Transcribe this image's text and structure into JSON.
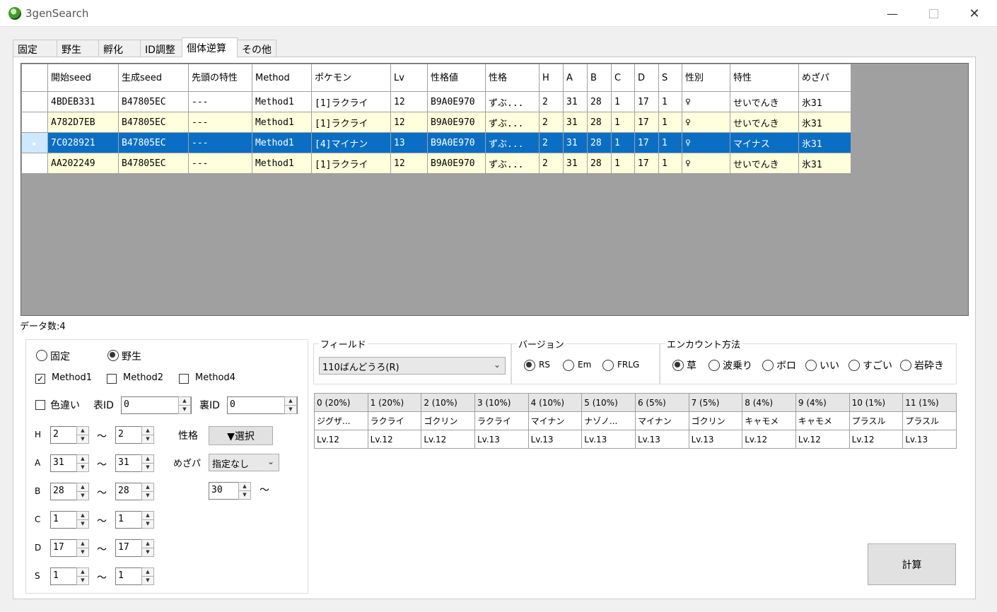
{
  "window": {
    "title": "3genSearch"
  },
  "tabs": [
    "固定",
    "野生",
    "孵化",
    "ID調整",
    "個体逆算",
    "その他"
  ],
  "results": {
    "columns": [
      "開始seed",
      "生成seed",
      "先頭の特性",
      "Method",
      "ポケモン",
      "Lv",
      "性格値",
      "性格",
      "H",
      "A",
      "B",
      "C",
      "D",
      "S",
      "性別",
      "特性",
      "めざパ"
    ],
    "rows": [
      [
        "4BDEB331",
        "B47805EC",
        "---",
        "Method1",
        "[1]ラクライ",
        "12",
        "B9A0E970",
        "ずぶ...",
        "2",
        "31",
        "28",
        "1",
        "17",
        "1",
        "♀",
        "せいでんき",
        "氷31"
      ],
      [
        "A782D7EB",
        "B47805EC",
        "---",
        "Method1",
        "[1]ラクライ",
        "12",
        "B9A0E970",
        "ずぶ...",
        "2",
        "31",
        "28",
        "1",
        "17",
        "1",
        "♀",
        "せいでんき",
        "氷31"
      ],
      [
        "7C028921",
        "B47805EC",
        "---",
        "Method1",
        "[4]マイナン",
        "13",
        "B9A0E970",
        "ずぶ...",
        "2",
        "31",
        "28",
        "1",
        "17",
        "1",
        "♀",
        "マイナス",
        "氷31"
      ],
      [
        "AA202249",
        "B47805EC",
        "---",
        "Method1",
        "[1]ラクライ",
        "12",
        "B9A0E970",
        "ずぶ...",
        "2",
        "31",
        "28",
        "1",
        "17",
        "1",
        "♀",
        "せいでんき",
        "氷31"
      ]
    ],
    "selected_row": 2
  },
  "count_label": "データ数:4",
  "mode": {
    "fixed": "固定",
    "wild": "野生",
    "selected": "野生"
  },
  "methods": [
    {
      "label": "Method1",
      "checked": true
    },
    {
      "label": "Method2",
      "checked": false
    },
    {
      "label": "Method4",
      "checked": false
    }
  ],
  "shiny": {
    "label": "色違い",
    "checked": false
  },
  "omote_id": {
    "label": "表ID",
    "value": "0"
  },
  "ura_id": {
    "label": "裏ID",
    "value": "0"
  },
  "stats": [
    {
      "label": "H",
      "min": "2",
      "max": "2"
    },
    {
      "label": "A",
      "min": "31",
      "max": "31"
    },
    {
      "label": "B",
      "min": "28",
      "max": "28"
    },
    {
      "label": "C",
      "min": "1",
      "max": "1"
    },
    {
      "label": "D",
      "min": "17",
      "max": "17"
    },
    {
      "label": "S",
      "min": "1",
      "max": "1"
    }
  ],
  "range_sep": "～",
  "nature": {
    "label": "性格",
    "button": "▼選択"
  },
  "hidden_power": {
    "label": "めざパ",
    "type": "指定なし",
    "power": "30",
    "sep": "～"
  },
  "field": {
    "legend": "フィールド",
    "value": "110ばんどうろ(R)"
  },
  "version": {
    "legend": "バージョン",
    "options": [
      "RS",
      "Em",
      "FRLG"
    ],
    "selected": "RS"
  },
  "encounter": {
    "legend": "エンカウント方法",
    "options": [
      "草",
      "波乗り",
      "ボロ",
      "いい",
      "すごい",
      "岩砕き"
    ],
    "selected": "草"
  },
  "slots": [
    {
      "slot": "0 (20%)",
      "name": "ジグザ...",
      "lv": "Lv.12"
    },
    {
      "slot": "1 (20%)",
      "name": "ラクライ",
      "lv": "Lv.12"
    },
    {
      "slot": "2 (10%)",
      "name": "ゴクリン",
      "lv": "Lv.12"
    },
    {
      "slot": "3 (10%)",
      "name": "ラクライ",
      "lv": "Lv.13"
    },
    {
      "slot": "4 (10%)",
      "name": "マイナン",
      "lv": "Lv.13"
    },
    {
      "slot": "5 (10%)",
      "name": "ナゾノ...",
      "lv": "Lv.13"
    },
    {
      "slot": "6 (5%)",
      "name": "マイナン",
      "lv": "Lv.13"
    },
    {
      "slot": "7 (5%)",
      "name": "ゴクリン",
      "lv": "Lv.13"
    },
    {
      "slot": "8 (4%)",
      "name": "キャモメ",
      "lv": "Lv.12"
    },
    {
      "slot": "9 (4%)",
      "name": "キャモメ",
      "lv": "Lv.12"
    },
    {
      "slot": "10 (1%)",
      "name": "プラスル",
      "lv": "Lv.12"
    },
    {
      "slot": "11 (1%)",
      "name": "プラスル",
      "lv": "Lv.13"
    }
  ],
  "calc_button": "計算"
}
